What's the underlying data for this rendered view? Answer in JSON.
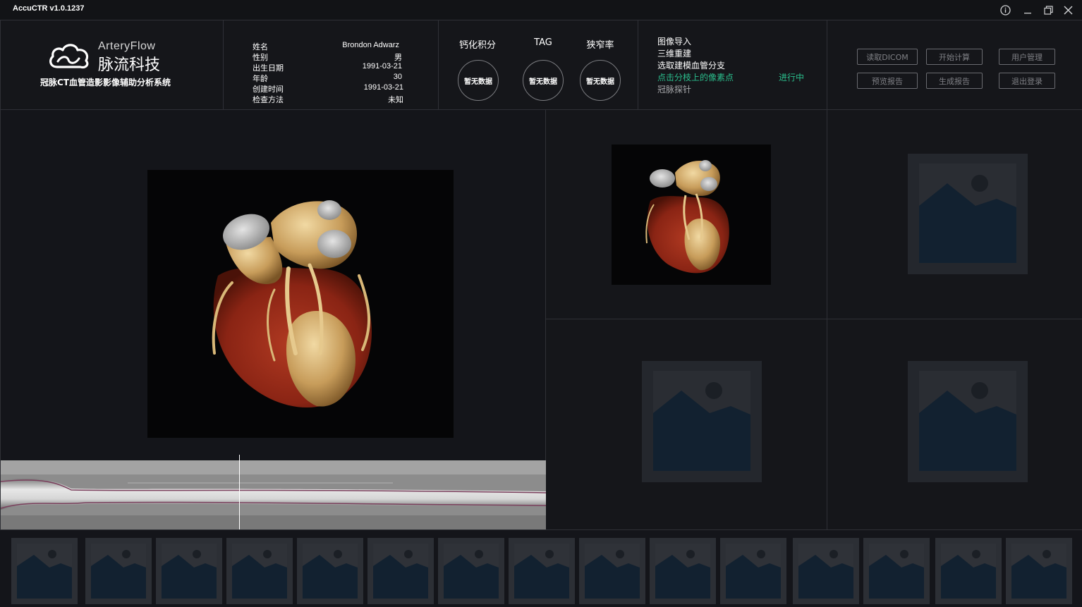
{
  "window": {
    "title": "AccuCTR  v1.0.1237"
  },
  "brand": {
    "name_en": "ArteryFlow",
    "name_cn": "脉流科技",
    "system_name": "冠脉CT血管造影影像辅助分析系统"
  },
  "patient": {
    "rows": [
      {
        "label": "姓名",
        "value": "Brondon Adwarz"
      },
      {
        "label": "性别",
        "value": "男"
      },
      {
        "label": "出生日期",
        "value": "1991-03-21"
      },
      {
        "label": "年龄",
        "value": "30"
      },
      {
        "label": "创建时间",
        "value": "1991-03-21"
      },
      {
        "label": "检查方法",
        "value": "未知"
      }
    ]
  },
  "metrics": [
    {
      "title": "钙化积分",
      "value": "暂无数据"
    },
    {
      "title": "TAG",
      "value": "暂无数据"
    },
    {
      "title": "狭窄率",
      "value": "暂无数据"
    }
  ],
  "workflow": {
    "steps": [
      {
        "label": "图像导入",
        "state": "done"
      },
      {
        "label": "三维重建",
        "state": "done"
      },
      {
        "label": "选取建模血管分支",
        "state": "done"
      },
      {
        "label": "点击分枝上的像素点",
        "state": "active"
      },
      {
        "label": "冠脉探针",
        "state": "pending"
      }
    ],
    "status": "进行中"
  },
  "actions": {
    "read_dicom": "读取DICOM",
    "start_calc": "开始计算",
    "user_mgmt": "用户管理",
    "preview_report": "预览报告",
    "gen_report": "生成报告",
    "logout": "退出登录"
  },
  "colors": {
    "accent_green": "#2bbf8d",
    "background": "#131418",
    "panel": "#15161a",
    "divider": "#2f3036",
    "placeholder_blue": "#122130"
  },
  "icons": {
    "info": "info-icon",
    "minimize": "minimize-icon",
    "restore": "restore-icon",
    "close": "close-icon",
    "logo": "cloud-logo-icon",
    "image_placeholder": "image-placeholder-icon"
  }
}
